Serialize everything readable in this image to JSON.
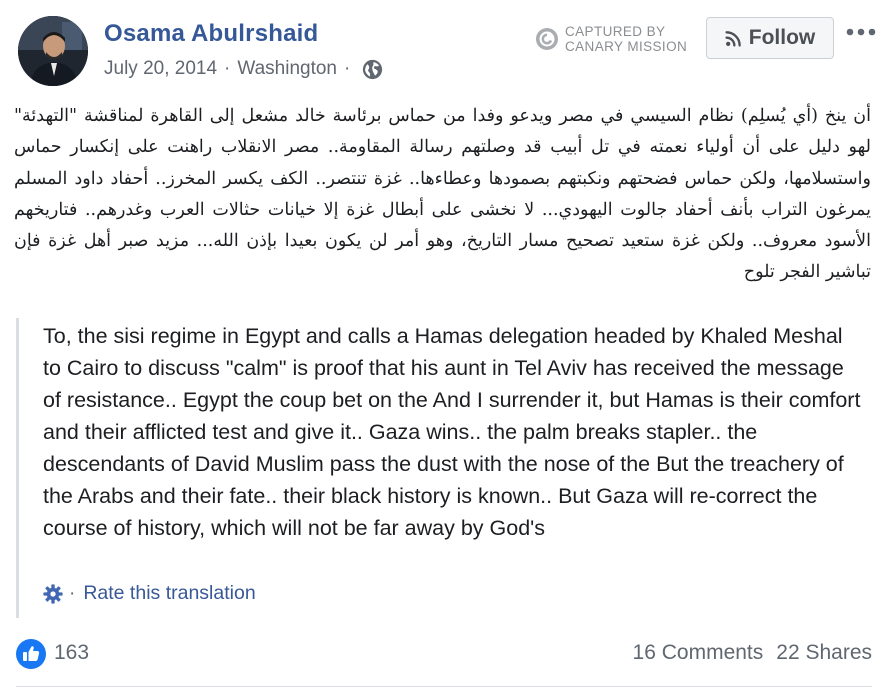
{
  "post": {
    "author": "Osama Abulrshaid",
    "date": "July 20, 2014",
    "separator": "·",
    "location": "Washington",
    "privacy_icon": "globe-icon",
    "follow_label": "Follow",
    "more_icon": "more-dots-icon"
  },
  "watermark": {
    "line1": "CAPTURED BY",
    "line2": "CANARY MISSION"
  },
  "body": {
    "arabic": "أن ينخ (أي يُسلِم) نظام السيسي في مصر ويدعو وفدا من حماس برئاسة خالد مشعل إلى القاهرة لمناقشة \"التهدئة\" لهو دليل على أن أولياء نعمته في تل أبيب قد وصلتهم رسالة المقاومة.. مصر الانقلاب راهنت على إنكسار حماس واستسلامها، ولكن حماس فضحتهم ونكبتهم بصمودها وعطاءها.. غزة تنتصر.. الكف يكسر المخرز.. أحفاد داود المسلم يمرغون التراب بأنف أحفاد جالوت اليهودي... لا نخشى على أبطال غزة إلا خيانات حثالات العرب وغدرهم.. فتاريخهم الأسود معروف.. ولكن غزة ستعيد تصحيح مسار التاريخ، وهو أمر لن يكون بعيدا بإذن الله... مزيد صبر أهل غزة فإن تباشير الفجر تلوح",
    "translation": "To, the sisi regime in Egypt and calls a Hamas delegation headed by Khaled Meshal to Cairo to discuss \"calm\" is proof that his aunt in Tel Aviv has received the message of resistance.. Egypt the coup bet on the And I surrender it, but Hamas is their comfort and their afflicted test and give it.. Gaza wins.. the palm breaks stapler.. the descendants of David Muslim pass the dust with the nose of the But the treachery of the Arabs and their fate.. their black history is known.. But Gaza will re-correct the course of history, which will not be far away by God's",
    "rate_label": "Rate this translation"
  },
  "stats": {
    "likes": "163",
    "comments": "16 Comments",
    "shares": "22 Shares"
  },
  "colors": {
    "link": "#365899",
    "secondary_text": "#606770",
    "like_blue": "#1877f2",
    "border": "#dadde1"
  }
}
